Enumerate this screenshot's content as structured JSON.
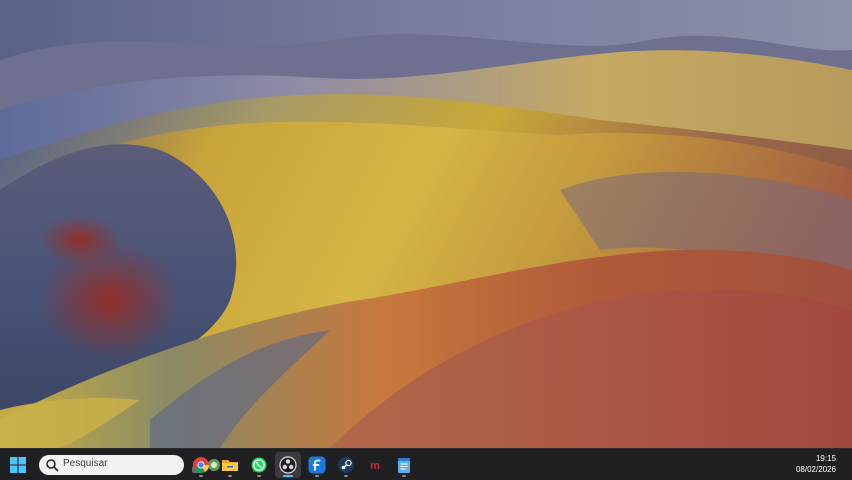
{
  "desktop": {
    "wallpaper": "colored-earth-dunes",
    "colors": {
      "sky_hills": "#6a6f8e",
      "ochre": "#c9a53a",
      "rust": "#b15a3a",
      "slate": "#4f5670"
    }
  },
  "taskbar": {
    "start_icon": "windows-logo-icon",
    "search": {
      "placeholder": "Pesquisar",
      "icon": "search-icon"
    },
    "apps": [
      {
        "name": "chrome",
        "icon": "chrome-icon"
      },
      {
        "name": "file-explorer",
        "icon": "folder-icon"
      },
      {
        "name": "whatsapp",
        "icon": "whatsapp-icon"
      },
      {
        "name": "obs-studio",
        "icon": "obs-icon",
        "active": true
      },
      {
        "name": "firefox-nightly",
        "icon": "firefox-icon"
      },
      {
        "name": "steam",
        "icon": "steam-icon"
      },
      {
        "name": "mendeley",
        "icon": "mendeley-icon"
      },
      {
        "name": "notepad",
        "icon": "notepad-icon"
      }
    ],
    "clock": {
      "time": "19:15",
      "date": "08/02/2026"
    },
    "colors": {
      "background": "#202023",
      "accent": "#4cc2ff"
    }
  }
}
